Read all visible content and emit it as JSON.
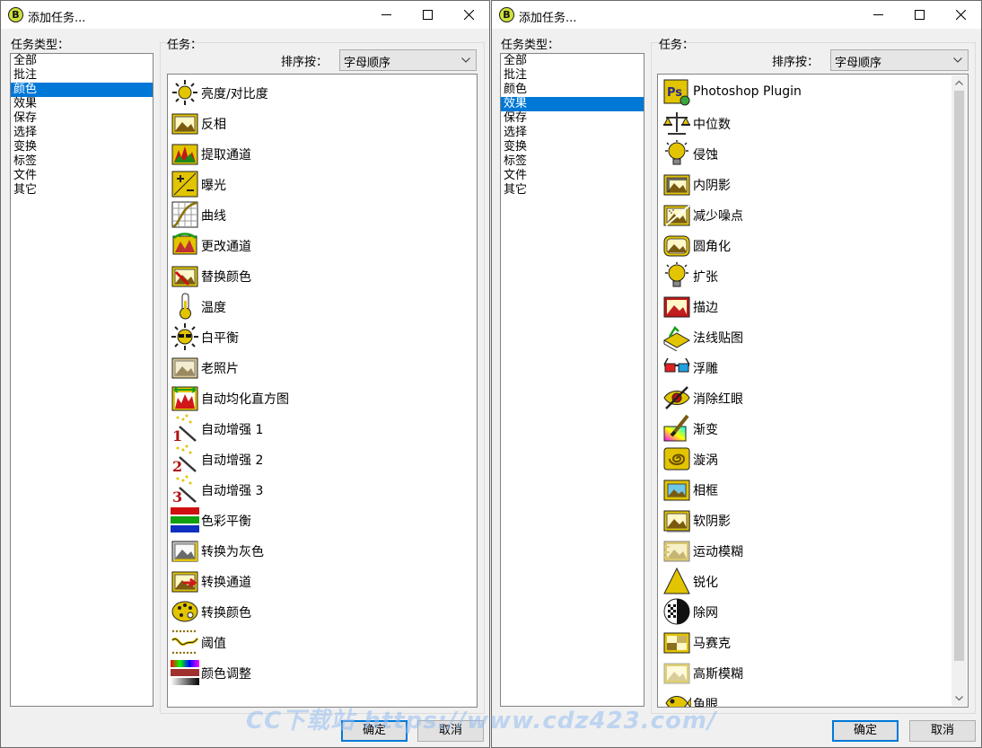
{
  "left_window": {
    "title": "添加任务...",
    "category_label": "任务类型：",
    "categories": [
      "全部",
      "批注",
      "颜色",
      "效果",
      "保存",
      "选择",
      "变换",
      "标签",
      "文件",
      "其它"
    ],
    "task_label": "任务：",
    "sort_label": "排序按：",
    "sort_value": "字母顺序",
    "tasks": [
      {
        "label": "亮度/对比度",
        "icon": "sun-icon"
      },
      {
        "label": "反相",
        "icon": "picture-icon"
      },
      {
        "label": "提取通道",
        "icon": "channels-icon"
      },
      {
        "label": "曝光",
        "icon": "exposure-icon"
      },
      {
        "label": "曲线",
        "icon": "curves-icon"
      },
      {
        "label": "更改通道",
        "icon": "channel-swap-icon"
      },
      {
        "label": "替换颜色",
        "icon": "replace-color-icon"
      },
      {
        "label": "温度",
        "icon": "thermometer-icon"
      },
      {
        "label": "白平衡",
        "icon": "sunglasses-sun-icon"
      },
      {
        "label": "老照片",
        "icon": "old-photo-icon"
      },
      {
        "label": "自动均化直方图",
        "icon": "histogram-icon"
      },
      {
        "label": "自动增强 1",
        "icon": "wand-1-icon"
      },
      {
        "label": "自动增强 2",
        "icon": "wand-2-icon"
      },
      {
        "label": "自动增强 3",
        "icon": "wand-3-icon"
      },
      {
        "label": "色彩平衡",
        "icon": "rgb-bars-icon"
      },
      {
        "label": "转换为灰色",
        "icon": "grayscale-icon"
      },
      {
        "label": "转换通道",
        "icon": "convert-channel-icon"
      },
      {
        "label": "转换颜色",
        "icon": "palette-icon"
      },
      {
        "label": "阈值",
        "icon": "threshold-icon"
      },
      {
        "label": "颜色调整",
        "icon": "color-adjust-icon"
      }
    ],
    "ok_label": "确定",
    "cancel_label": "取消"
  },
  "right_window": {
    "title": "添加任务...",
    "category_label": "任务类型：",
    "categories": [
      "全部",
      "批注",
      "颜色",
      "效果",
      "保存",
      "选择",
      "变换",
      "标签",
      "文件",
      "其它"
    ],
    "task_label": "任务：",
    "sort_label": "排序按：",
    "sort_value": "字母顺序",
    "tasks": [
      {
        "label": "Photoshop Plugin",
        "icon": "ps-plugin-icon"
      },
      {
        "label": "中位数",
        "icon": "scales-icon"
      },
      {
        "label": "侵蚀",
        "icon": "bulb-icon"
      },
      {
        "label": "内阴影",
        "icon": "inner-shadow-icon"
      },
      {
        "label": "减少噪点",
        "icon": "denoise-icon"
      },
      {
        "label": "圆角化",
        "icon": "round-corners-icon"
      },
      {
        "label": "扩张",
        "icon": "bulb-icon"
      },
      {
        "label": "描边",
        "icon": "stroke-icon"
      },
      {
        "label": "法线贴图",
        "icon": "normal-map-icon"
      },
      {
        "label": "浮雕",
        "icon": "3d-glasses-icon"
      },
      {
        "label": "消除红眼",
        "icon": "red-eye-icon"
      },
      {
        "label": "渐变",
        "icon": "gradient-brush-icon"
      },
      {
        "label": "漩涡",
        "icon": "swirl-icon"
      },
      {
        "label": "相框",
        "icon": "frame-icon"
      },
      {
        "label": "软阴影",
        "icon": "soft-shadow-icon"
      },
      {
        "label": "运动模糊",
        "icon": "motion-blur-icon"
      },
      {
        "label": "锐化",
        "icon": "sharpen-icon"
      },
      {
        "label": "除网",
        "icon": "descreen-icon"
      },
      {
        "label": "马赛克",
        "icon": "mosaic-icon"
      },
      {
        "label": "高斯模糊",
        "icon": "gaussian-blur-icon"
      },
      {
        "label": "鱼眼",
        "icon": "fish-eye-icon"
      }
    ],
    "ok_label": "确定",
    "cancel_label": "取消"
  },
  "watermark": "CC下载站 https://www.cdz423.com/",
  "colors": {
    "selection": "#0078d7",
    "icon_gold": "#e2c400"
  }
}
